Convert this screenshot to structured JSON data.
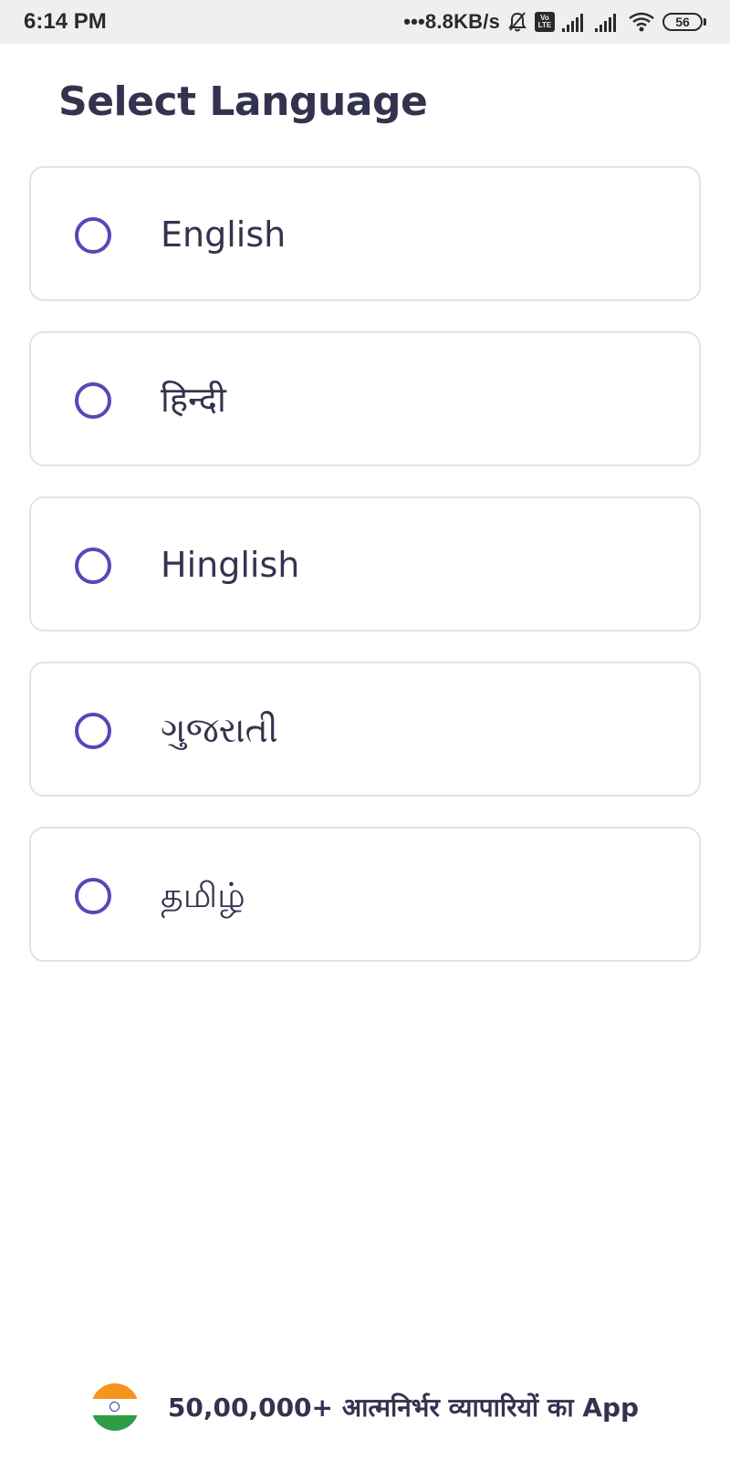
{
  "status_bar": {
    "time": "6:14 PM",
    "network_speed": "•••8.8KB/s",
    "volte_top": "Vo",
    "volte_bottom": "LTE",
    "battery": "56",
    "icons": [
      "mute-bell-icon",
      "volte-icon",
      "signal-icon",
      "signal-icon",
      "wifi-icon",
      "battery-icon"
    ]
  },
  "page": {
    "title": "Select Language"
  },
  "languages": [
    {
      "label": "English",
      "selected": false
    },
    {
      "label": "हिन्दी",
      "selected": false
    },
    {
      "label": "Hinglish",
      "selected": false
    },
    {
      "label": "ગુજરાતી",
      "selected": false
    },
    {
      "label": "தமிழ்",
      "selected": false
    }
  ],
  "footer": {
    "text": "50,00,000+ आत्मनिर्भर व्यापारियों का App",
    "icon": "india-flag-icon"
  },
  "colors": {
    "accent": "#5a45b9",
    "text": "#34334f",
    "card_border": "#e3e3e6",
    "status_bar_bg": "#efefef"
  }
}
